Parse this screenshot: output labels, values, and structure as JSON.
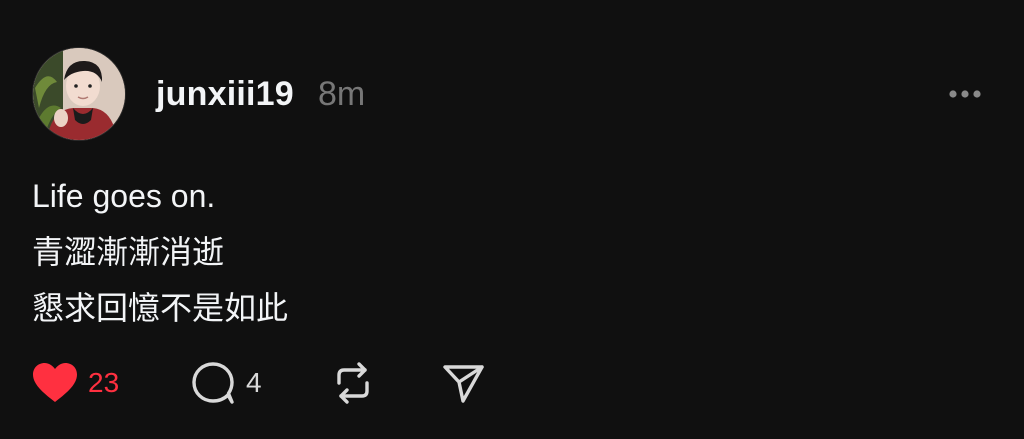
{
  "post": {
    "username": "junxiii19",
    "timestamp": "8m",
    "content_lines": [
      "Life goes on.",
      "青澀漸漸消逝",
      "懇求回憶不是如此"
    ],
    "actions": {
      "like": {
        "icon": "heart-filled-icon",
        "count": "23",
        "color": "#ff3040",
        "liked": true
      },
      "reply": {
        "icon": "comment-icon",
        "count": "4"
      },
      "repost": {
        "icon": "repost-icon"
      },
      "share": {
        "icon": "send-icon"
      }
    },
    "more": {
      "icon": "more-horizontal-icon"
    }
  }
}
